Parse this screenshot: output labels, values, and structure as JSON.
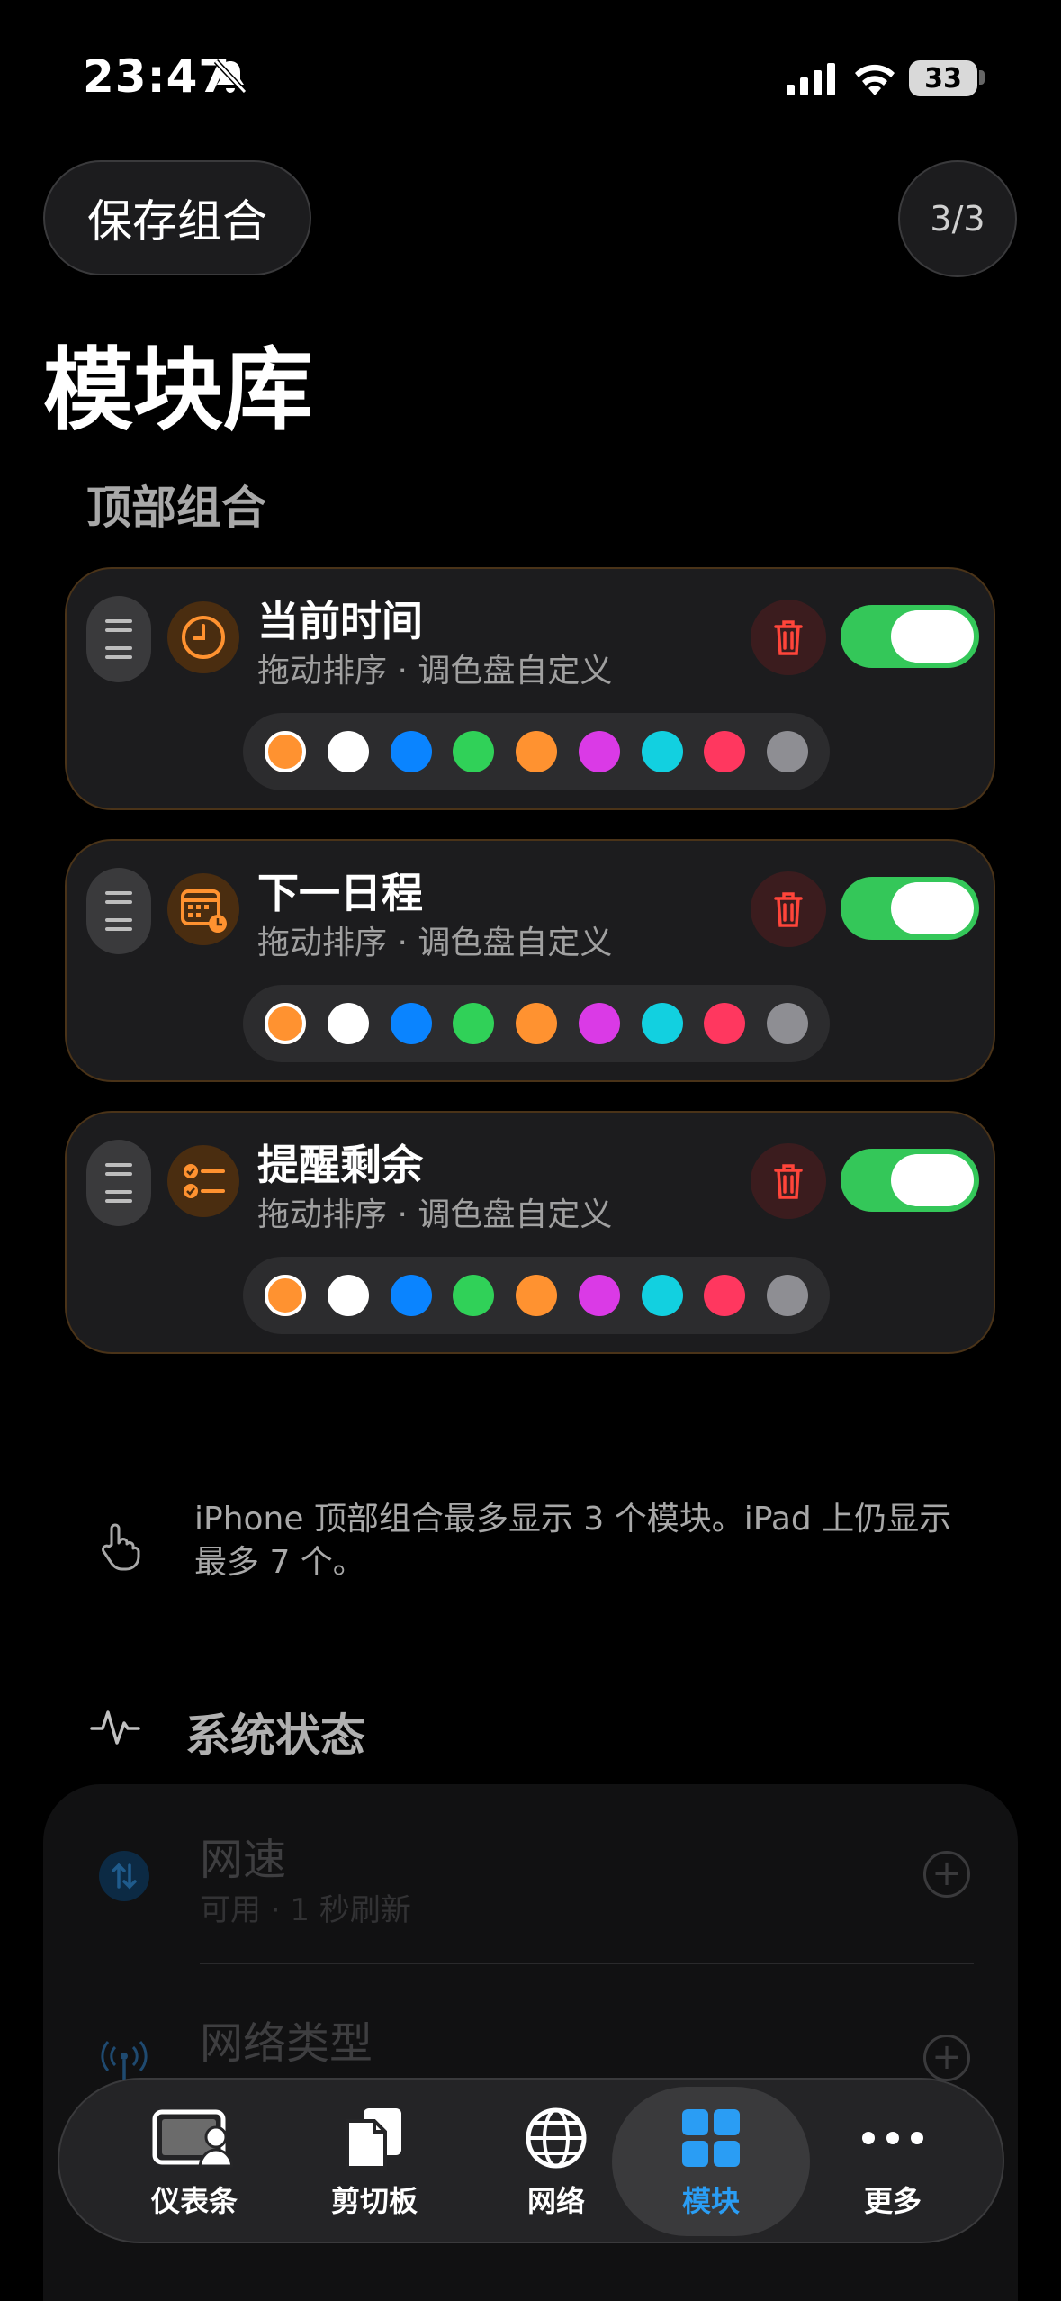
{
  "status": {
    "time": "23:47",
    "battery": "33"
  },
  "header": {
    "save_label": "保存组合",
    "page_indicator": "3/3"
  },
  "title": "模块库",
  "section_top": "顶部组合",
  "modules": [
    {
      "title": "当前时间",
      "subtitle": "拖动排序 · 调色盘自定义",
      "enabled": true,
      "icon": "clock-icon"
    },
    {
      "title": "下一日程",
      "subtitle": "拖动排序 · 调色盘自定义",
      "enabled": true,
      "icon": "calendar-icon"
    },
    {
      "title": "提醒剩余",
      "subtitle": "拖动排序 · 调色盘自定义",
      "enabled": true,
      "icon": "checklist-icon"
    }
  ],
  "palette": [
    "#ff9230",
    "#ffffff",
    "#0a84ff",
    "#30d158",
    "#ff9230",
    "#da3ae6",
    "#12d0e0",
    "#ff375f",
    "#8e8e93"
  ],
  "info_text": "iPhone 顶部组合最多显示 3 个模块。iPad 上仍显示最多 7 个。",
  "section_system": "系统状态",
  "system_items": [
    {
      "title": "网速",
      "subtitle": "可用 · 1 秒刷新",
      "icon": "network-speed-icon"
    },
    {
      "title": "网络类型",
      "icon": "antenna-icon"
    }
  ],
  "tabs": [
    {
      "label": "仪表条",
      "icon": "dashboard-icon"
    },
    {
      "label": "剪切板",
      "icon": "clipboard-icon"
    },
    {
      "label": "网络",
      "icon": "globe-icon"
    },
    {
      "label": "模块",
      "icon": "grid-icon",
      "active": true
    },
    {
      "label": "更多",
      "icon": "more-icon"
    }
  ],
  "colors": {
    "accent": "#34c759",
    "tab_active": "#2a9df4",
    "module_icon": "#ff9230",
    "trash": "#ff453a"
  }
}
